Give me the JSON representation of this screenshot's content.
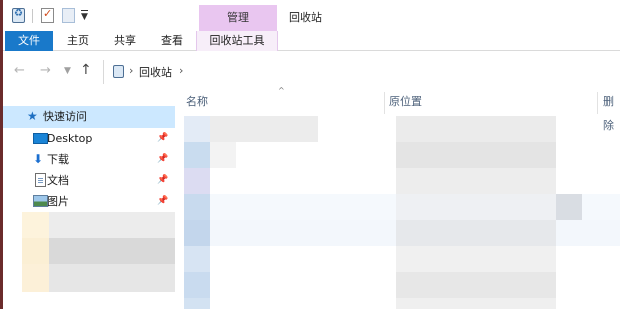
{
  "titlebar": {
    "manage_context_label": "管理",
    "window_title": "回收站"
  },
  "icons": {
    "recycle_bin": "recycle-bin-icon",
    "properties": "properties-icon",
    "new_folder": "new-folder-icon",
    "quick_access": "star-icon",
    "pin": "pin-icon"
  },
  "ribbon": {
    "tabs": [
      {
        "label": "文件"
      },
      {
        "label": "主页"
      },
      {
        "label": "共享"
      },
      {
        "label": "查看"
      },
      {
        "label": "回收站工具"
      }
    ],
    "accent_color": "#1979ca",
    "context_color": "#e9c6f0"
  },
  "address": {
    "path": "回收站"
  },
  "nav_pane": {
    "items": [
      {
        "label": "快速访问",
        "selected": true
      },
      {
        "label": "Desktop",
        "pinned": true
      },
      {
        "label": "下载",
        "pinned": true
      },
      {
        "label": "文档",
        "pinned": true
      },
      {
        "label": "图片",
        "pinned": true
      }
    ]
  },
  "columns": {
    "name": "名称",
    "original_location": "原位置",
    "date_deleted": "删除"
  }
}
